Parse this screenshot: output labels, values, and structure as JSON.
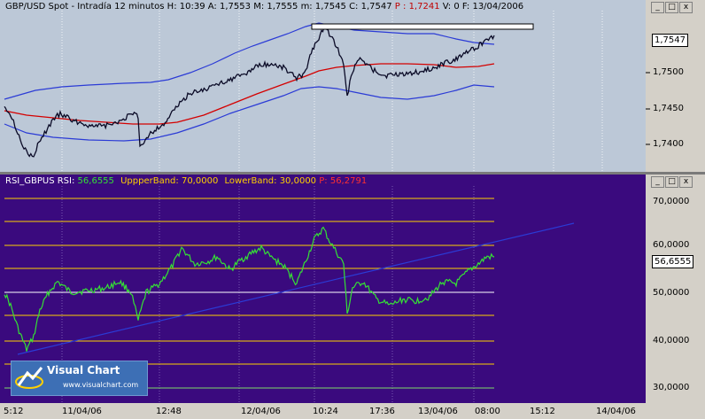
{
  "price_panel": {
    "title_parts": {
      "symbol": "GBP/USD Spot - Intradía 12 minutos",
      "h_label": "H:",
      "h_value": "10:39",
      "a_label": "A:",
      "a_value": "1,7553",
      "m_label": "M:",
      "m_value": "1,7555",
      "m2_label": "m:",
      "m2_value": "1,7545",
      "c_label": "C:",
      "c_value": "1,7547",
      "p_label": "P :",
      "p_value": "1,7241",
      "v_label": "V:",
      "v_value": "0",
      "f_label": "F:",
      "f_value": "13/04/2006"
    },
    "axis_ticks": [
      "1,7500",
      "1,7450",
      "1,7400"
    ],
    "current_price_badge": "1,7547",
    "window_buttons": [
      "_",
      "□",
      "x"
    ]
  },
  "rsi_panel": {
    "title_parts": {
      "label": "RSI_GBPUS RSI:",
      "rsi_value": "56,6555",
      "upper_label": "UppperBand:",
      "upper_value": "70,0000",
      "lower_label": "LowerBand:",
      "lower_value": "30,0000",
      "p_label": "P:",
      "p_value": "56,2791"
    },
    "axis_ticks": [
      "70,0000",
      "60,0000",
      "50,0000",
      "40,0000",
      "30,0000"
    ],
    "current_rsi_badge": "56,6555",
    "window_buttons": [
      "_",
      "□",
      "x"
    ]
  },
  "time_axis": [
    "5:12",
    "11/04/06",
    "12:48",
    "12/04/06",
    "10:24",
    "17:36",
    "13/04/06",
    "08:00",
    "15:12",
    "14/04/06"
  ],
  "logo": {
    "title": "Visual Chart",
    "url": "www.visualchart.com"
  },
  "colors": {
    "price_bg": "#bcc8d7",
    "rsi_bg": "#3a0a7e",
    "bollinger": "#2b3bd6",
    "mid_band": "#d40000",
    "rsi_line": "#35e035",
    "band_yellow": "#ffd000",
    "band_green": "#7fd86a",
    "red_text": "#c00000"
  }
}
